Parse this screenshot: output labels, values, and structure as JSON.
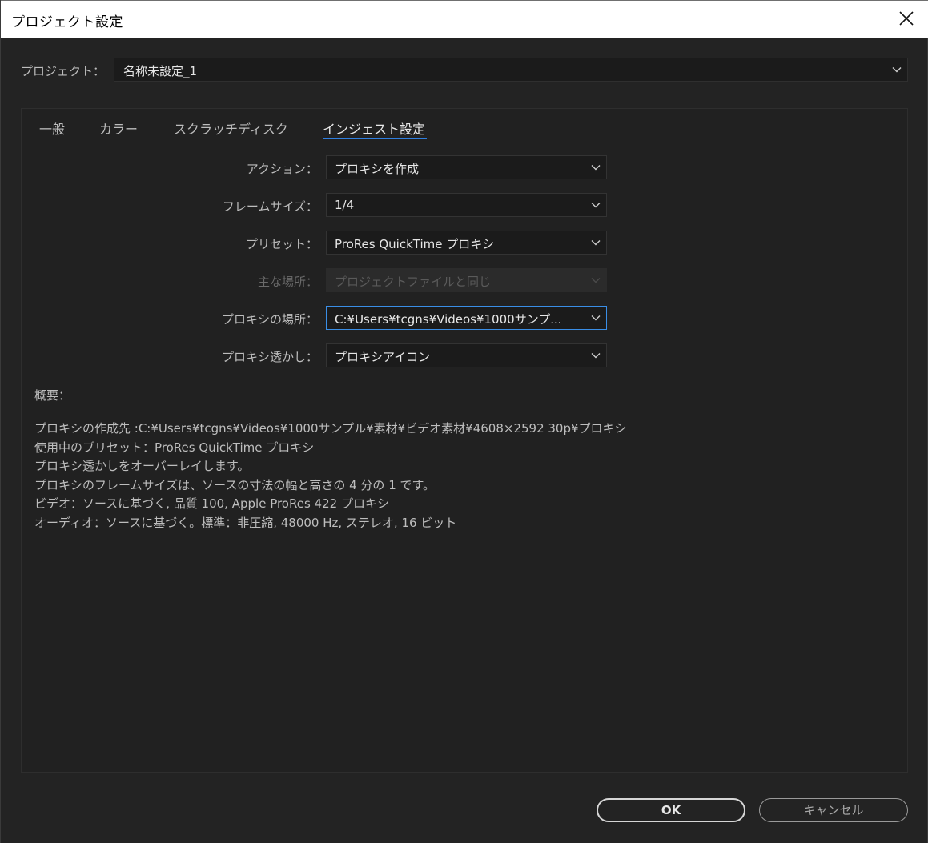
{
  "window": {
    "title": "プロジェクト設定"
  },
  "project": {
    "label": "プロジェクト：",
    "value": "名称未設定_1"
  },
  "tabs": [
    {
      "label": "一般",
      "active": false
    },
    {
      "label": "カラー",
      "active": false
    },
    {
      "label": "スクラッチディスク",
      "active": false
    },
    {
      "label": "インジェスト設定",
      "active": true
    }
  ],
  "fields": {
    "action": {
      "label": "アクション：",
      "value": "プロキシを作成"
    },
    "frame_size": {
      "label": "フレームサイズ：",
      "value": "1/4"
    },
    "preset": {
      "label": "プリセット：",
      "value": "ProRes QuickTime プロキシ"
    },
    "primary_location": {
      "label": "主な場所：",
      "value": "プロジェクトファイルと同じ",
      "disabled": true
    },
    "proxy_location": {
      "label": "プロキシの場所：",
      "value": "C:¥Users¥tcgns¥Videos¥1000サンプ..."
    },
    "proxy_watermark": {
      "label": "プロキシ透かし：",
      "value": "プロキシアイコン"
    }
  },
  "summary": {
    "label": "概要：",
    "lines": [
      "プロキシの作成先 :C:¥Users¥tcgns¥Videos¥1000サンプル¥素材¥ビデオ素材¥4608×2592  30p¥プロキシ",
      "使用中のプリセット：ProRes QuickTime プロキシ",
      "プロキシ透かしをオーバーレイします。",
      "プロキシのフレームサイズは、ソースの寸法の幅と高さの 4 分の 1 です。",
      "ビデオ：ソースに基づく, 品質 100, Apple ProRes 422 プロキシ",
      "オーディオ：ソースに基づく。標準：非圧縮, 48000 Hz, ステレオ, 16 ビット"
    ]
  },
  "buttons": {
    "ok": "OK",
    "cancel": "キャンセル"
  },
  "colors": {
    "accent": "#2f7fe0",
    "background": "#232323"
  },
  "icons": {
    "close": "close-icon",
    "dropdown": "chevron-down-icon"
  }
}
